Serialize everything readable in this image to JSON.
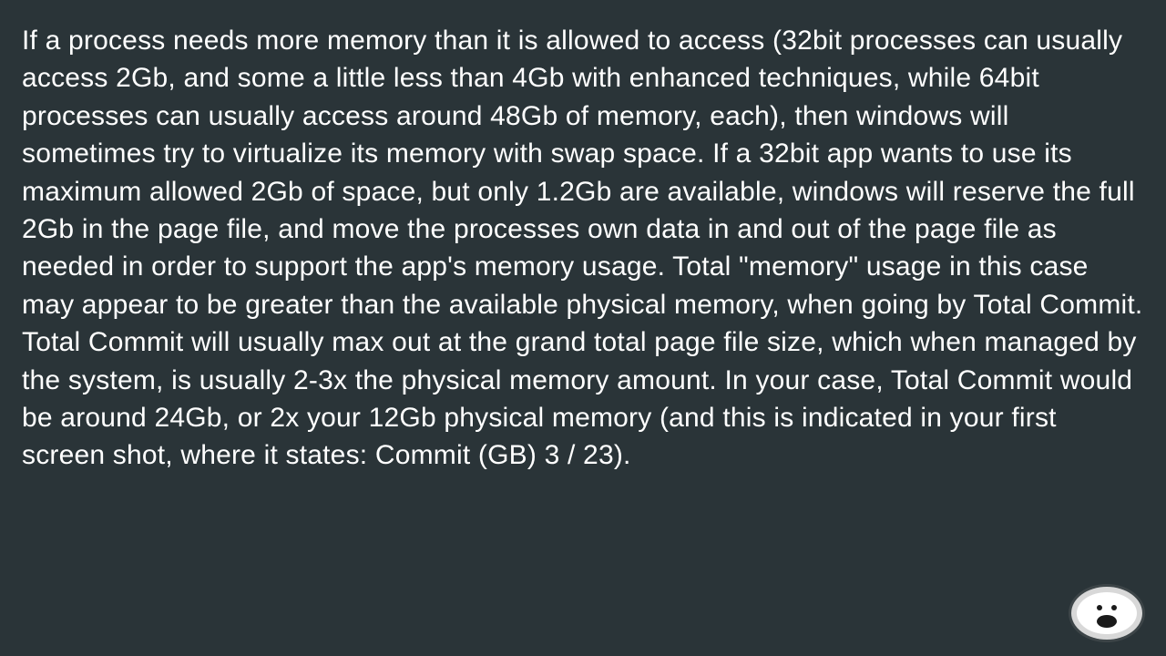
{
  "content": {
    "paragraph": "If a process needs more memory than it is allowed to access (32bit processes can usually access 2Gb, and some a little less than 4Gb with enhanced techniques, while 64bit processes can usually access around 48Gb of memory, each), then windows will sometimes try to virtualize its memory with swap space. If a 32bit app wants to use its maximum allowed 2Gb of space, but only 1.2Gb are available, windows will reserve the full 2Gb in the page file, and move the processes own data in and out of the page file as needed in order to support the app's memory usage. Total \"memory\" usage in this case may appear to be greater than the available physical memory, when going by Total Commit. Total Commit will usually max out at the grand total page file size, which when managed by the system, is usually 2-3x the physical memory amount. In your case, Total Commit would be around 24Gb, or 2x your 12Gb physical memory (and this is indicated in your first screen shot, where it states: Commit (GB) 3 / 23)."
  },
  "avatar": {
    "name": "cartoon-face-avatar"
  }
}
